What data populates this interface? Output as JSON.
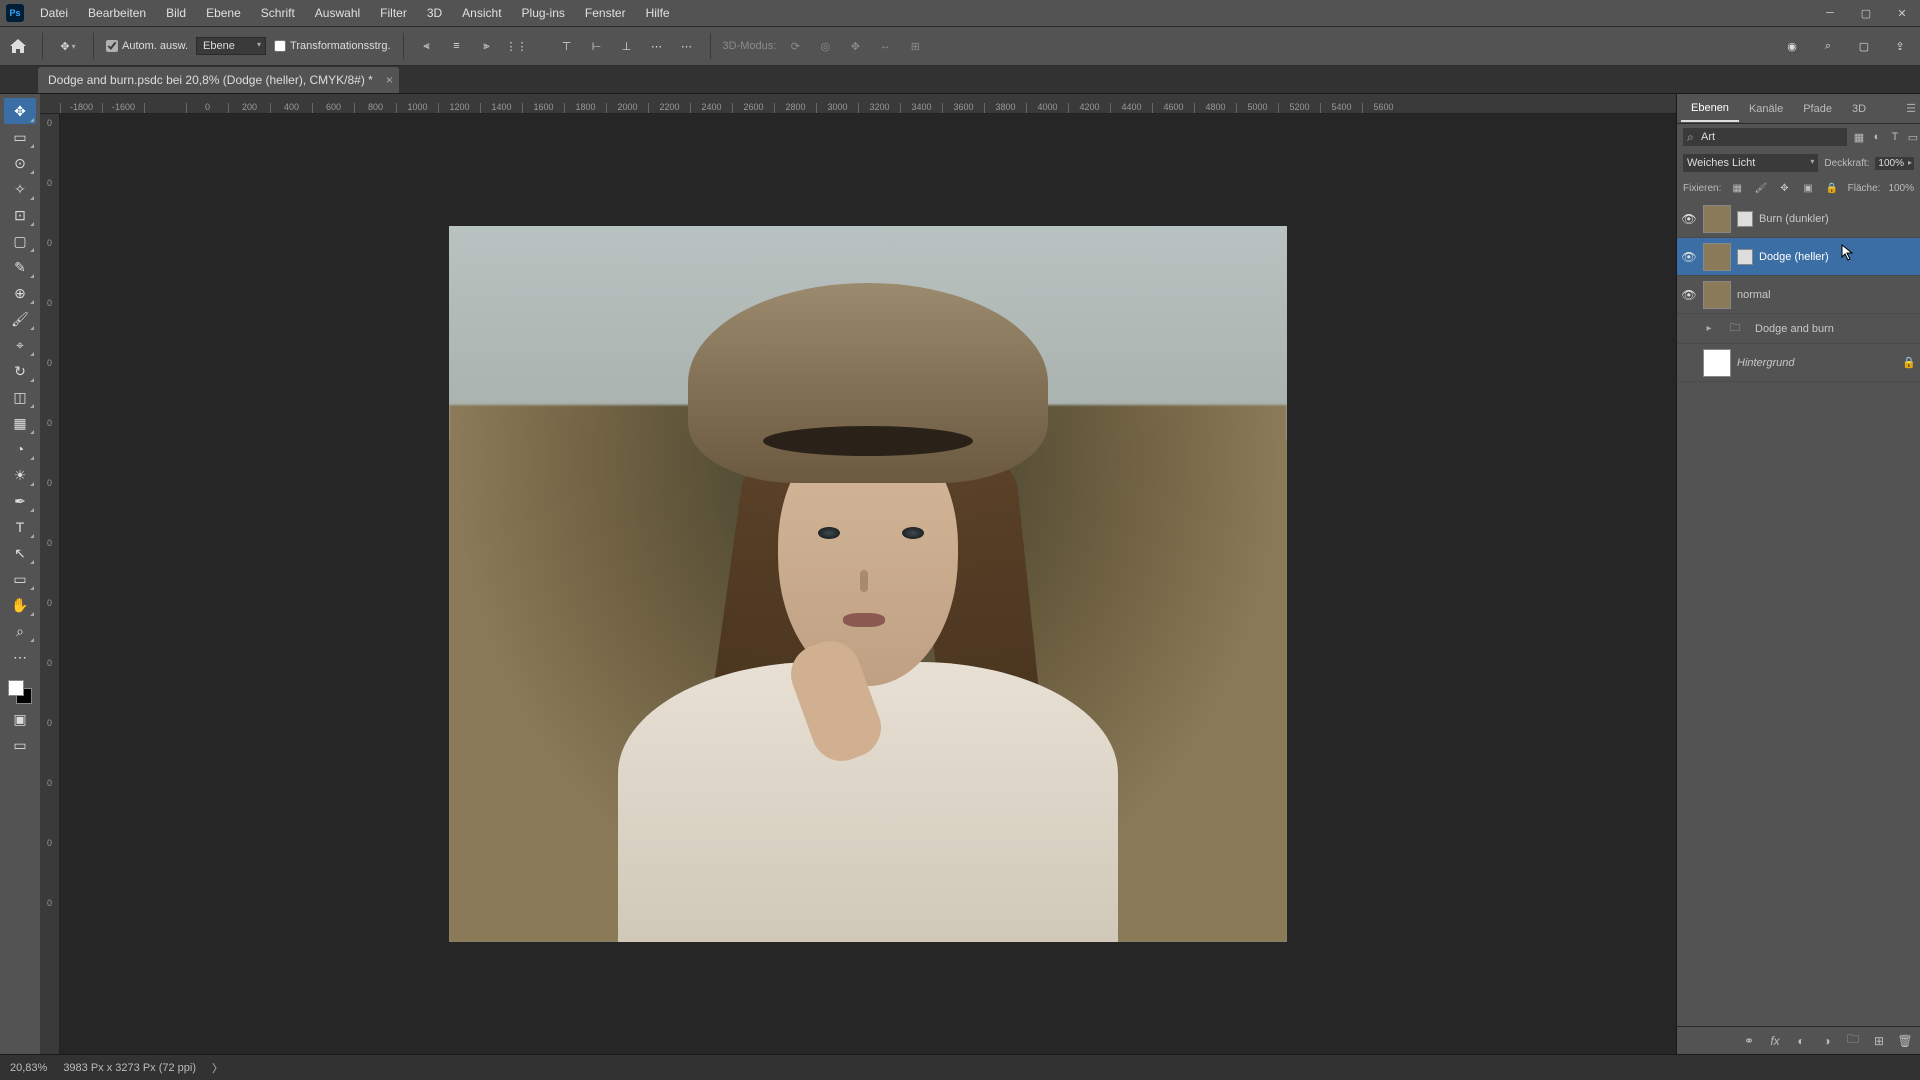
{
  "menu": {
    "items": [
      "Datei",
      "Bearbeiten",
      "Bild",
      "Ebene",
      "Schrift",
      "Auswahl",
      "Filter",
      "3D",
      "Ansicht",
      "Plug-ins",
      "Fenster",
      "Hilfe"
    ],
    "logo": "Ps"
  },
  "options": {
    "auto_select_label": "Autom. ausw.",
    "target_dd": "Ebene",
    "transform_controls_label": "Transformationsstrg.",
    "mode3d_label": "3D-Modus:"
  },
  "doctab": {
    "title": "Dodge and burn.psdc bei 20,8% (Dodge (heller), CMYK/8#) *"
  },
  "ruler_h": [
    "-1800",
    "-1600",
    "",
    "0",
    "200",
    "400",
    "600",
    "800",
    "1000",
    "1200",
    "1400",
    "1600",
    "1800",
    "2000",
    "2200",
    "2400",
    "2600",
    "2800",
    "3000",
    "3200",
    "3400",
    "3600",
    "3800",
    "4000",
    "4200",
    "4400",
    "4600",
    "4800",
    "5000",
    "5200",
    "5400",
    "5600"
  ],
  "ruler_v": [
    "0",
    "0",
    "0",
    "0",
    "0",
    "0",
    "0",
    "0",
    "0",
    "0",
    "0",
    "0",
    "0",
    "0"
  ],
  "panel_tabs": {
    "t1": "Ebenen",
    "t2": "Kanäle",
    "t3": "Pfade",
    "t4": "3D"
  },
  "filter": {
    "type_label": "Art"
  },
  "blend": {
    "mode": "Weiches Licht",
    "opacity_label": "Deckkraft:",
    "opacity_val": "100%",
    "lock_label": "Fixieren:",
    "fill_label": "Fläche:",
    "fill_val": "100%"
  },
  "layers": [
    {
      "name": "Burn (dunkler)",
      "visible": true,
      "type": "curves"
    },
    {
      "name": "Dodge (heller)",
      "visible": true,
      "type": "curves",
      "selected": true
    },
    {
      "name": "normal",
      "visible": true,
      "type": "smart"
    },
    {
      "name": "Dodge and burn",
      "visible": false,
      "type": "group"
    },
    {
      "name": "Hintergrund",
      "visible": false,
      "type": "bg",
      "locked": true,
      "italic": true
    }
  ],
  "status": {
    "zoom": "20,83%",
    "docinfo": "3983 Px x 3273 Px (72 ppi)"
  },
  "icons": {
    "move": "✥",
    "marquee": "▭",
    "lasso": "⊙",
    "wand": "✧",
    "crop": "⊡",
    "frame": "▢",
    "eyedrop": "✎",
    "heal": "⊕",
    "brush": "🖌",
    "stamp": "⌖",
    "history": "↻",
    "eraser": "◫",
    "grad": "▦",
    "blur": "◔",
    "dodge": "☀",
    "pen": "✒",
    "type": "T",
    "path": "↖",
    "rect": "▭",
    "hand": "✋",
    "zoom": "⌕",
    "more": "⋯"
  }
}
